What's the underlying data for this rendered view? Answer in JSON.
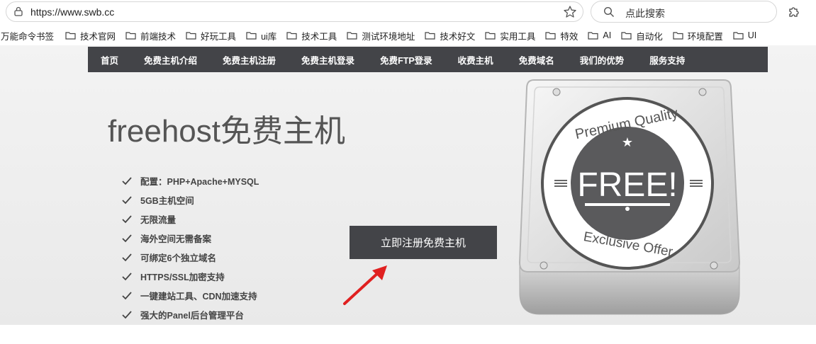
{
  "browser": {
    "url": "https://www.swb.cc",
    "search_placeholder": "点此搜索",
    "icons": {
      "lock": "lock-icon",
      "star": "star-icon",
      "search": "search-icon",
      "extension": "extension-icon"
    }
  },
  "bookmarks": {
    "first": "万能命令书签",
    "items": [
      "技术官网",
      "前端技术",
      "好玩工具",
      "ui库",
      "技术工具",
      "测试环境地址",
      "技术好文",
      "实用工具",
      "特效",
      "AI",
      "自动化",
      "环境配置",
      "UI"
    ]
  },
  "nav": {
    "items": [
      "首页",
      "免费主机介绍",
      "免费主机注册",
      "免费主机登录",
      "免费FTP登录",
      "收费主机",
      "免费域名",
      "我们的优势",
      "服务支持"
    ]
  },
  "hero": {
    "title": "freehost免费主机",
    "features": [
      "配置：PHP+Apache+MYSQL",
      "5GB主机空间",
      "无限流量",
      "海外空间无需备案",
      "可绑定6个独立域名",
      "HTTPS/SSL加密支持",
      "一键建站工具、CDN加速支持",
      "强大的Panel后台管理平台"
    ],
    "cta_label": "立即注册免费主机"
  },
  "badge": {
    "top_text": "Premium Quality",
    "center_text": "FREE!",
    "bottom_text": "Exclusive Offer"
  },
  "colors": {
    "nav_bg": "#434448",
    "annotation_arrow": "#e02020"
  }
}
